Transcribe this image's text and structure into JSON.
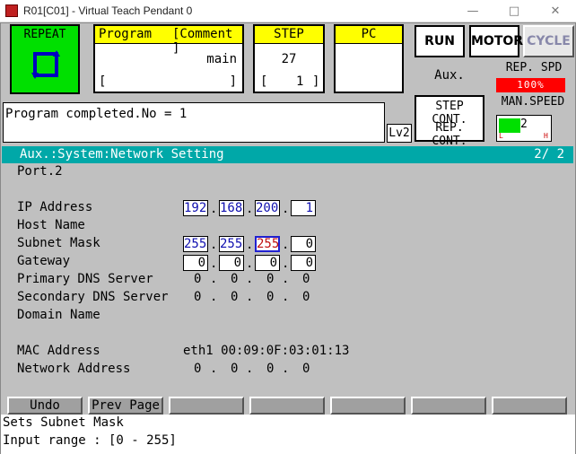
{
  "window": {
    "title": "R01[C01] - Virtual Teach Pendant 0",
    "minimize_icon": "minimize-icon",
    "maximize_icon": "maximize-icon",
    "close_icon": "close-icon"
  },
  "top": {
    "repeat_label": "REPEAT",
    "program": {
      "header_left": "Program",
      "header_right": "[Comment ]",
      "value": "main",
      "bracket_left": "[",
      "bracket_right": "]"
    },
    "step": {
      "header": "STEP",
      "value": "27",
      "sub_left": "[",
      "sub_value": "1",
      "sub_right": "]"
    },
    "pc": {
      "header": "PC"
    },
    "run_label": "RUN",
    "motor_label": "MOTOR",
    "cycle_label": "CYCLE",
    "aux_label": "Aux.",
    "rep_spd_label": "REP. SPD",
    "rep_spd_value": "100%",
    "step_cont_label": "STEP CONT.",
    "rep_cont_label": "REP. CONT.",
    "man_speed_label": "MAN.SPEED",
    "man_speed_level": "2",
    "man_speed_l": "L",
    "man_speed_h": "H"
  },
  "message": {
    "text": "Program completed.No = 1",
    "level": "Lv2"
  },
  "screen": {
    "title": "Aux.:System:Network Setting",
    "page": "2/  2",
    "port": "Port.2",
    "rows": {
      "ip_label": "IP Address",
      "ip": [
        "192",
        "168",
        "200",
        "1"
      ],
      "host_label": "Host Name",
      "subnet_label": "Subnet Mask",
      "subnet": [
        "255",
        "255",
        "255",
        "0"
      ],
      "gateway_label": "Gateway",
      "gateway": [
        "0",
        "0",
        "0",
        "0"
      ],
      "dns1_label": "Primary DNS Server",
      "dns1": [
        "0",
        "0",
        "0",
        "0"
      ],
      "dns2_label": "Secondary DNS Server",
      "dns2": [
        "0",
        "0",
        "0",
        "0"
      ],
      "domain_label": "Domain Name",
      "mac_label": "MAC Address",
      "mac_value": "eth1 00:09:0F:03:01:13",
      "netaddr_label": "Network Address",
      "netaddr": [
        "0",
        "0",
        "0",
        "0"
      ]
    },
    "separator": "."
  },
  "fkeys": [
    "Undo",
    "Prev Page",
    "",
    "",
    "",
    "",
    ""
  ],
  "status": {
    "line1": "Sets Subnet Mask",
    "line2": "Input range : [0  - 255]"
  },
  "colors": {
    "teal": "#00a8a8",
    "green": "#00e000",
    "yellow": "#ffff00",
    "red": "#ff0000"
  }
}
